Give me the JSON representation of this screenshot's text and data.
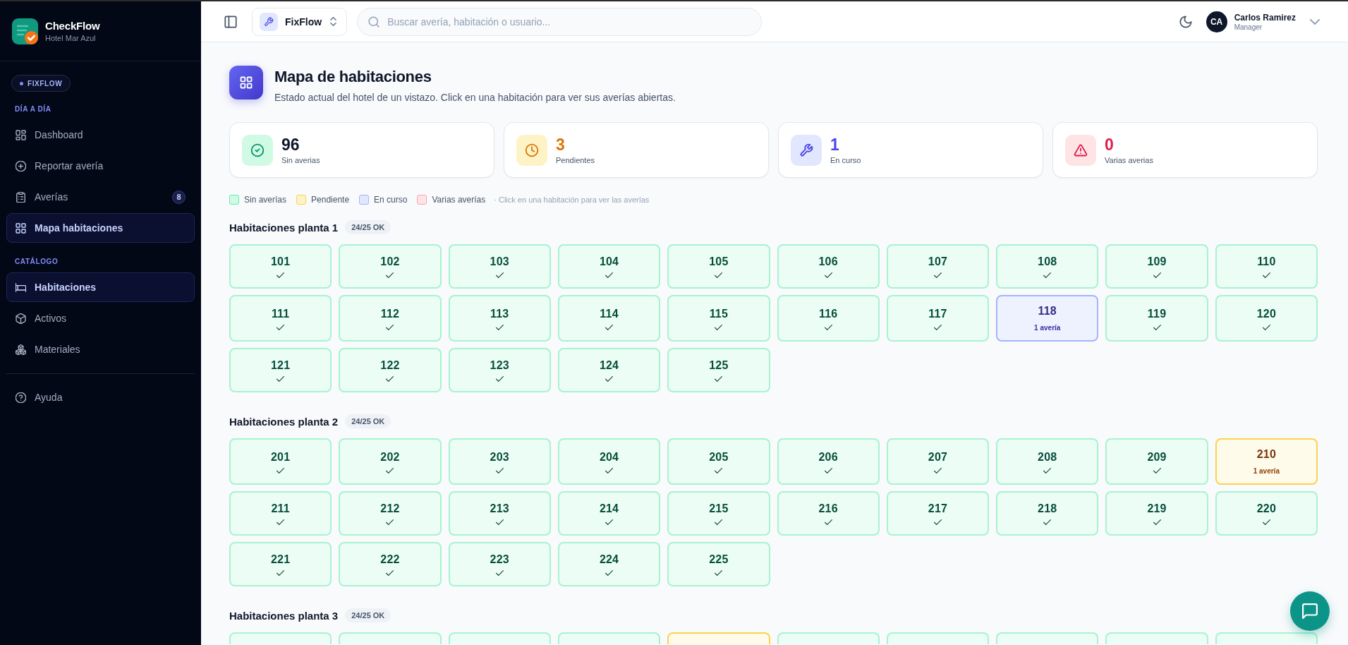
{
  "sidebar": {
    "brand": {
      "name": "CheckFlow",
      "subtitle": "Hotel Mar Azul"
    },
    "module_badge": "FIXFLOW",
    "sections": [
      {
        "title": "DÍA A DÍA",
        "items": [
          {
            "label": "Dashboard",
            "selected": false
          },
          {
            "label": "Reportar avería",
            "selected": false
          },
          {
            "label": "Averías",
            "badge": "8",
            "selected": false
          },
          {
            "label": "Mapa habitaciones",
            "selected": true
          }
        ]
      },
      {
        "title": "CATÁLOGO",
        "items": [
          {
            "label": "Habitaciones",
            "selected": true
          },
          {
            "label": "Activos",
            "selected": false
          },
          {
            "label": "Materiales",
            "selected": false
          }
        ]
      }
    ],
    "footer_items": [
      {
        "label": "Ayuda",
        "selected": false
      }
    ]
  },
  "topbar": {
    "workspace": "FixFlow",
    "search": {
      "placeholder": "Buscar avería, habitación o usuario..."
    },
    "user": {
      "initials": "CA",
      "name": "Carlos Ramirez",
      "role": "Manager"
    }
  },
  "header": {
    "title": "Mapa de habitaciones",
    "subtitle": "Estado actual del hotel de un vistazo. Click en una habitación para ver sus averías abiertas."
  },
  "stats": [
    {
      "kind": "ok",
      "value": "96",
      "label": "Sin averias"
    },
    {
      "kind": "pending",
      "value": "3",
      "label": "Pendientes"
    },
    {
      "kind": "progress",
      "value": "1",
      "label": "En curso"
    },
    {
      "kind": "multiple",
      "value": "0",
      "label": "Varias averias"
    }
  ],
  "legend": {
    "items": [
      {
        "kind": "ok",
        "label": "Sin averías"
      },
      {
        "kind": "pending",
        "label": "Pendiente"
      },
      {
        "kind": "progress",
        "label": "En curso"
      },
      {
        "kind": "multiple",
        "label": "Varias averías"
      }
    ],
    "hint": "· Click en una habitación para ver las averías"
  },
  "floors": [
    {
      "title": "Habitaciones planta 1",
      "badge": "24/25 OK",
      "rooms": [
        {
          "number": "101",
          "kind": "ok"
        },
        {
          "number": "102",
          "kind": "ok"
        },
        {
          "number": "103",
          "kind": "ok"
        },
        {
          "number": "104",
          "kind": "ok"
        },
        {
          "number": "105",
          "kind": "ok"
        },
        {
          "number": "106",
          "kind": "ok"
        },
        {
          "number": "107",
          "kind": "ok"
        },
        {
          "number": "108",
          "kind": "ok"
        },
        {
          "number": "109",
          "kind": "ok"
        },
        {
          "number": "110",
          "kind": "ok"
        },
        {
          "number": "111",
          "kind": "ok"
        },
        {
          "number": "112",
          "kind": "ok"
        },
        {
          "number": "113",
          "kind": "ok"
        },
        {
          "number": "114",
          "kind": "ok"
        },
        {
          "number": "115",
          "kind": "ok"
        },
        {
          "number": "116",
          "kind": "ok"
        },
        {
          "number": "117",
          "kind": "ok"
        },
        {
          "number": "118",
          "kind": "progress",
          "faults": "1 avería"
        },
        {
          "number": "119",
          "kind": "ok"
        },
        {
          "number": "120",
          "kind": "ok"
        },
        {
          "number": "121",
          "kind": "ok"
        },
        {
          "number": "122",
          "kind": "ok"
        },
        {
          "number": "123",
          "kind": "ok"
        },
        {
          "number": "124",
          "kind": "ok"
        },
        {
          "number": "125",
          "kind": "ok"
        }
      ]
    },
    {
      "title": "Habitaciones planta 2",
      "badge": "24/25 OK",
      "rooms": [
        {
          "number": "201",
          "kind": "ok"
        },
        {
          "number": "202",
          "kind": "ok"
        },
        {
          "number": "203",
          "kind": "ok"
        },
        {
          "number": "204",
          "kind": "ok"
        },
        {
          "number": "205",
          "kind": "ok"
        },
        {
          "number": "206",
          "kind": "ok"
        },
        {
          "number": "207",
          "kind": "ok"
        },
        {
          "number": "208",
          "kind": "ok"
        },
        {
          "number": "209",
          "kind": "ok"
        },
        {
          "number": "210",
          "kind": "pending",
          "faults": "1 avería"
        },
        {
          "number": "211",
          "kind": "ok"
        },
        {
          "number": "212",
          "kind": "ok"
        },
        {
          "number": "213",
          "kind": "ok"
        },
        {
          "number": "214",
          "kind": "ok"
        },
        {
          "number": "215",
          "kind": "ok"
        },
        {
          "number": "216",
          "kind": "ok"
        },
        {
          "number": "217",
          "kind": "ok"
        },
        {
          "number": "218",
          "kind": "ok"
        },
        {
          "number": "219",
          "kind": "ok"
        },
        {
          "number": "220",
          "kind": "ok"
        },
        {
          "number": "221",
          "kind": "ok"
        },
        {
          "number": "222",
          "kind": "ok"
        },
        {
          "number": "223",
          "kind": "ok"
        },
        {
          "number": "224",
          "kind": "ok"
        },
        {
          "number": "225",
          "kind": "ok"
        }
      ]
    },
    {
      "title": "Habitaciones planta 3",
      "badge": "24/25 OK",
      "rooms": [
        {
          "kind": "ok"
        },
        {
          "kind": "ok"
        },
        {
          "kind": "ok"
        },
        {
          "kind": "ok"
        },
        {
          "kind": "pending"
        },
        {
          "kind": "ok"
        },
        {
          "kind": "ok"
        },
        {
          "kind": "ok"
        },
        {
          "kind": "ok"
        },
        {
          "kind": "ok"
        }
      ]
    }
  ]
}
